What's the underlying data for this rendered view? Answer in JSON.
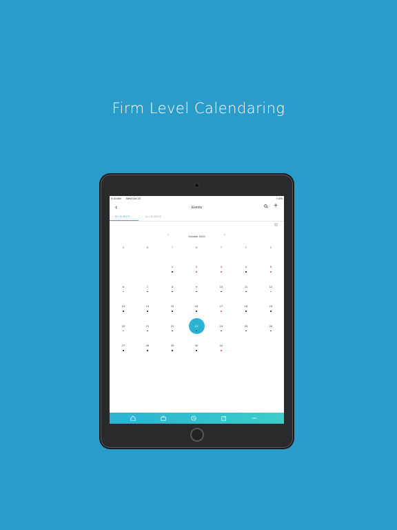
{
  "headline": "Firm Level Calendaring",
  "status_bar": {
    "time": "9:43 AM",
    "date": "Wed Oct 23",
    "battery": "6%"
  },
  "nav": {
    "title": "Events",
    "back_icon": "chevron-left-icon",
    "search_icon": "search-icon",
    "add_icon": "plus-icon"
  },
  "tabs": [
    {
      "label": "MY EVENTS",
      "active": true
    },
    {
      "label": "ALL EVENTS",
      "active": false
    }
  ],
  "month": {
    "label": "October 2019"
  },
  "weekdays": [
    "S",
    "M",
    "T",
    "W",
    "T",
    "F",
    "S"
  ],
  "weeks": [
    [
      null,
      null,
      {
        "day": "1",
        "dot": "#222"
      },
      {
        "day": "2",
        "dot": "#e0556a"
      },
      {
        "day": "3",
        "dot": "#e0556a"
      },
      {
        "day": "4",
        "dot": "#222"
      },
      {
        "day": "5",
        "dot": "#e0556a"
      }
    ],
    [
      {
        "day": "6",
        "dot": "#e0556a"
      },
      {
        "day": "7",
        "dot": "#222"
      },
      {
        "day": "8",
        "dot": "#222"
      },
      {
        "day": "9",
        "dot": "#222"
      },
      {
        "day": "10",
        "dot": "#222"
      },
      {
        "day": "11",
        "dot": "#222"
      },
      {
        "day": "12",
        "dot": "#e0556a"
      }
    ],
    [
      {
        "day": "13",
        "dot": "#222"
      },
      {
        "day": "14",
        "dot": "#222"
      },
      {
        "day": "15",
        "dot": "#222"
      },
      {
        "day": "16",
        "dot": "#222"
      },
      {
        "day": "17",
        "dot": "#e0556a"
      },
      {
        "day": "18",
        "dot": "#222"
      },
      {
        "day": "19",
        "dot": "#222"
      }
    ],
    [
      {
        "day": "20",
        "dot": "#e0556a"
      },
      {
        "day": "21",
        "dot": "#222"
      },
      {
        "day": "22",
        "dot": "#222"
      },
      {
        "day": "23",
        "dot": "#222",
        "selected": true
      },
      {
        "day": "24",
        "dot": "#222"
      },
      {
        "day": "25",
        "dot": "#222"
      },
      {
        "day": "26",
        "dot": "#222"
      }
    ],
    [
      {
        "day": "27",
        "dot": "#222"
      },
      {
        "day": "28",
        "dot": "#222"
      },
      {
        "day": "29",
        "dot": "#222"
      },
      {
        "day": "30",
        "dot": "#222"
      },
      {
        "day": "31",
        "dot": "#e0556a"
      },
      null,
      null
    ]
  ],
  "tabbar": {
    "items": [
      {
        "icon": "home-icon"
      },
      {
        "icon": "briefcase-icon"
      },
      {
        "icon": "clock-icon"
      },
      {
        "icon": "compose-icon"
      },
      {
        "icon": "more-icon"
      }
    ]
  },
  "colors": {
    "background": "#2b9cc9",
    "accent": "#2bb2d4",
    "dot_red": "#e0556a",
    "dot_dark": "#222222"
  }
}
